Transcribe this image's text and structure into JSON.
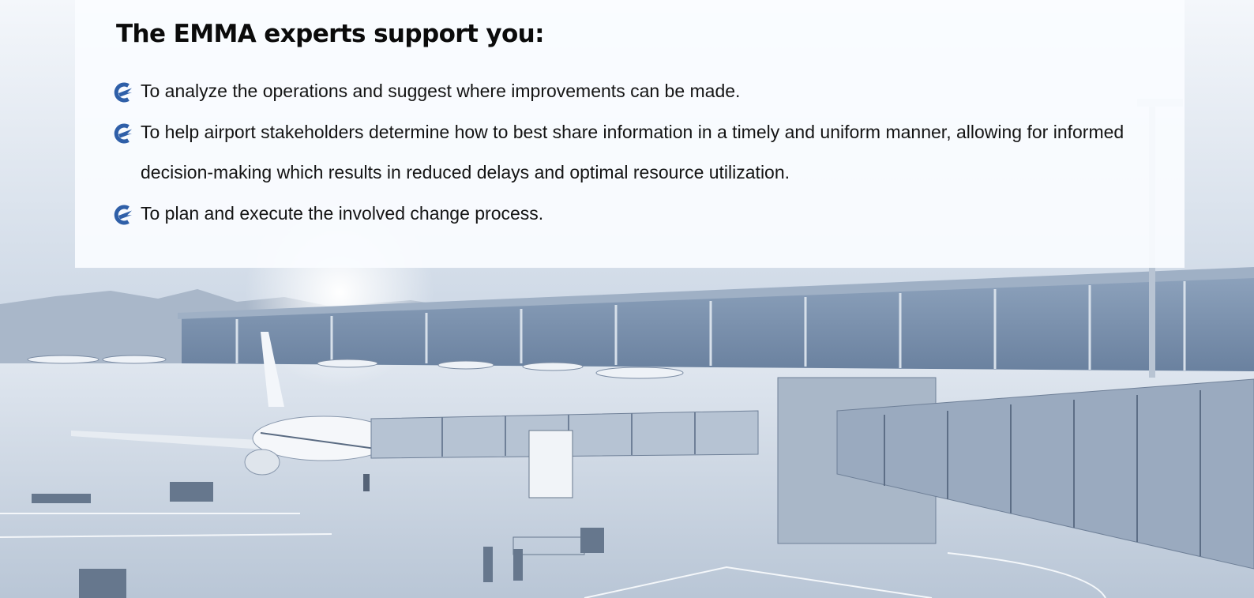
{
  "panel": {
    "heading": "The EMMA experts support you:",
    "items": [
      {
        "text": "To analyze the operations and suggest where improvements can be made."
      },
      {
        "text": "To help airport stakeholders determine how to best share information in a timely and uniform manner, allowing for informed decision-making which results in reduced delays and optimal resource utilization."
      },
      {
        "text": "To plan and execute the involved change process."
      }
    ]
  },
  "colors": {
    "bullet_icon": "#2f5fa8",
    "heading_text": "#0b0b0b",
    "body_text": "#141414",
    "sky": "#dce4ee"
  },
  "icons": {
    "bullet": "emma-logo-icon"
  }
}
